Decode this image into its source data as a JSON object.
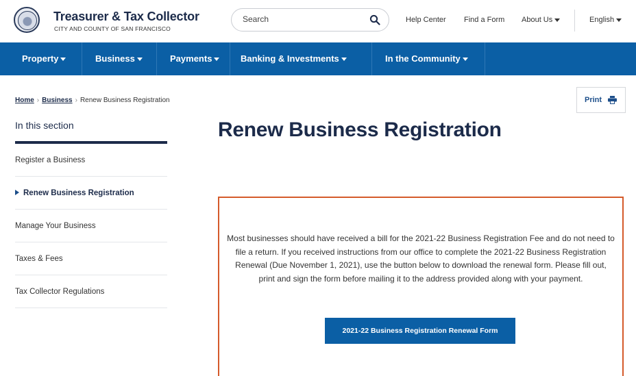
{
  "header": {
    "title": "Treasurer & Tax Collector",
    "subtitle": "CITY AND COUNTY OF SAN FRANCISCO",
    "search_placeholder": "Search",
    "links": {
      "help": "Help Center",
      "form": "Find a Form",
      "about": "About Us",
      "language": "English"
    }
  },
  "nav": {
    "items": [
      "Property",
      "Business",
      "Payments",
      "Banking & Investments",
      "In the Community"
    ]
  },
  "breadcrumb": {
    "home": "Home",
    "business": "Business",
    "current": "Renew Business Registration"
  },
  "print_label": "Print",
  "sidebar": {
    "heading": "In this section",
    "items": [
      "Register a Business",
      "Renew Business Registration",
      "Manage Your Business",
      "Taxes & Fees",
      "Tax Collector Regulations"
    ]
  },
  "main": {
    "title": "Renew Business Registration",
    "notice_text": "Most businesses should have received a bill for the 2021-22 Business Registration Fee and do not need to file a return. If you received instructions from our office to complete the 2021-22 Business Registration Renewal (Due November 1, 2021), use the button below to download the renewal form.  Please fill out, print and sign the form before mailing it to the address provided along with your payment.",
    "button_label": "2021-22  Business Registration Renewal Form"
  },
  "colors": {
    "nav_blue": "#0b5fa5",
    "heading_navy": "#1c2b4a",
    "notice_border": "#d45a2a"
  },
  "icons": [
    "seal-logo-icon",
    "search-icon",
    "caret-down-icon",
    "printer-icon",
    "triangle-right-icon"
  ]
}
